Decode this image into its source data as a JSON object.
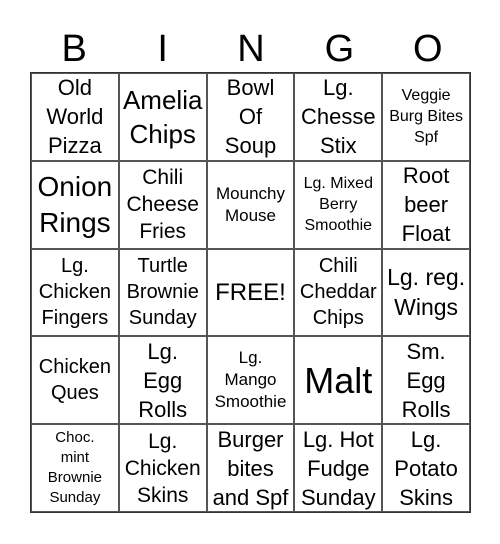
{
  "header": [
    "B",
    "I",
    "N",
    "G",
    "O"
  ],
  "cells": [
    {
      "lines": [
        "Old",
        "World",
        "Pizza"
      ],
      "size": 22
    },
    {
      "lines": [
        "Amelia",
        "Chips"
      ],
      "size": 26
    },
    {
      "lines": [
        "Bowl",
        "Of",
        "Soup"
      ],
      "size": 22
    },
    {
      "lines": [
        "Lg.",
        "Chesse",
        "Stix"
      ],
      "size": 22
    },
    {
      "lines": [
        "Veggie",
        "Burg Bites",
        "Spf"
      ],
      "size": 16
    },
    {
      "lines": [
        "Onion",
        "Rings"
      ],
      "size": 28
    },
    {
      "lines": [
        "Chili",
        "Cheese",
        "Fries"
      ],
      "size": 21
    },
    {
      "lines": [
        "Mounchy",
        "Mouse"
      ],
      "size": 17
    },
    {
      "lines": [
        "Lg. Mixed",
        "Berry",
        "Smoothie"
      ],
      "size": 16
    },
    {
      "lines": [
        "Root",
        "beer",
        "Float"
      ],
      "size": 22
    },
    {
      "lines": [
        "Lg.",
        "Chicken",
        "Fingers"
      ],
      "size": 20
    },
    {
      "lines": [
        "Turtle",
        "Brownie",
        "Sunday"
      ],
      "size": 20
    },
    {
      "lines": [
        "FREE!"
      ],
      "size": 24
    },
    {
      "lines": [
        "Chili",
        "Cheddar",
        "Chips"
      ],
      "size": 20
    },
    {
      "lines": [
        "Lg. reg.",
        "Wings"
      ],
      "size": 23
    },
    {
      "lines": [
        "Chicken",
        "Ques"
      ],
      "size": 20
    },
    {
      "lines": [
        "Lg.",
        "Egg",
        "Rolls"
      ],
      "size": 22
    },
    {
      "lines": [
        "Lg.",
        "Mango",
        "Smoothie"
      ],
      "size": 17
    },
    {
      "lines": [
        "Malt"
      ],
      "size": 36
    },
    {
      "lines": [
        "Sm.",
        "Egg",
        "Rolls"
      ],
      "size": 22
    },
    {
      "lines": [
        "Choc.",
        "mint",
        "Brownie",
        "Sunday"
      ],
      "size": 15
    },
    {
      "lines": [
        "Lg.",
        "Chicken",
        "Skins"
      ],
      "size": 21
    },
    {
      "lines": [
        "Burger",
        "bites",
        "and Spf"
      ],
      "size": 22
    },
    {
      "lines": [
        "Lg. Hot",
        "Fudge",
        "Sunday"
      ],
      "size": 22
    },
    {
      "lines": [
        "Lg.",
        "Potato",
        "Skins"
      ],
      "size": 22
    }
  ]
}
